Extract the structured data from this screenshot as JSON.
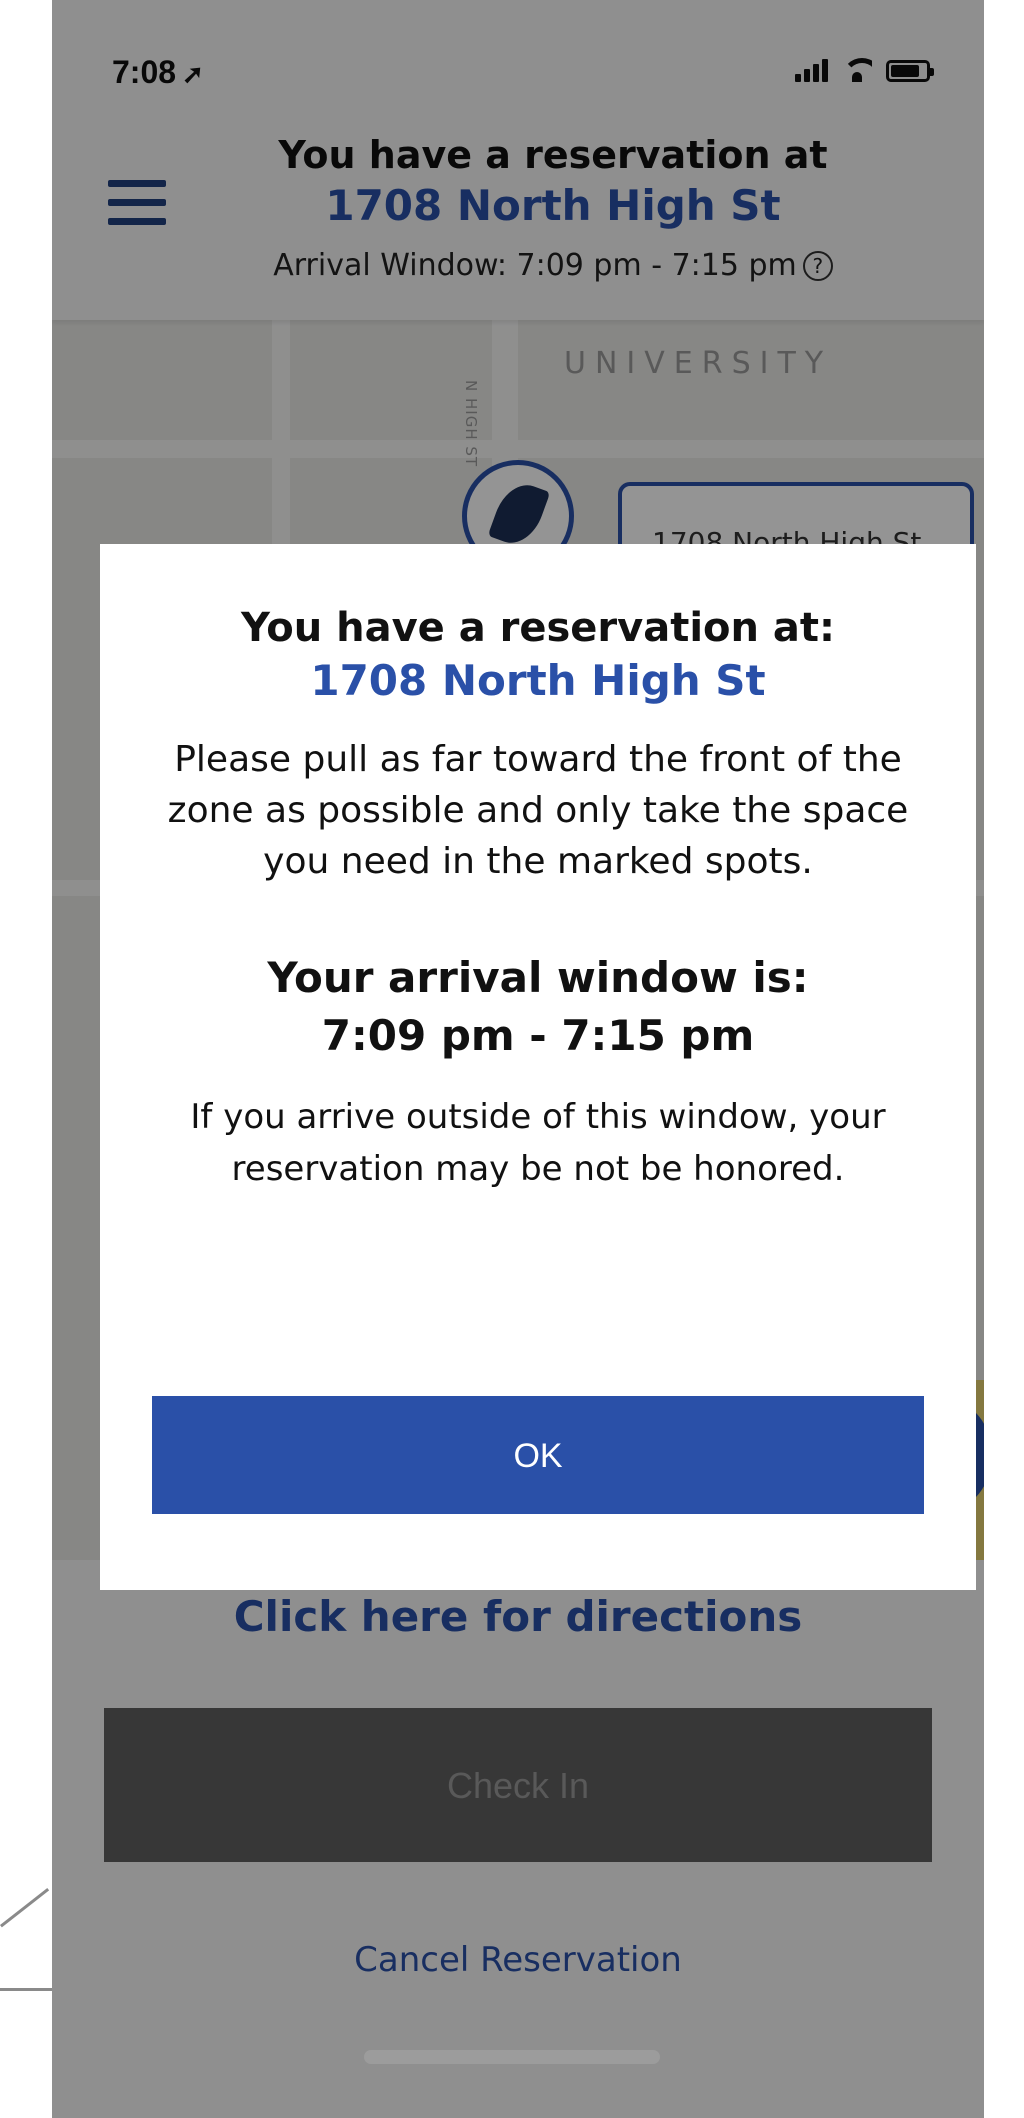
{
  "status_bar": {
    "time": "7:08",
    "location_icon": "location-arrow-icon",
    "signal_icon": "cellular-signal-icon",
    "wifi_icon": "wifi-icon",
    "battery_icon": "battery-icon"
  },
  "header": {
    "menu_icon": "hamburger-menu-icon",
    "title": "You have a reservation at",
    "address": "1708 North High St",
    "arrival_window": "Arrival Window: 7:09 pm - 7:15 pm",
    "help_icon": "question-circle-icon",
    "help_glyph": "?"
  },
  "map": {
    "area_label": "UNIVERSITY",
    "street_label": "N HIGH ST",
    "marker_icon": "location-marker-icon",
    "marker_callout": "1708 North High St"
  },
  "modal": {
    "title": "You have a reservation at:",
    "address": "1708 North High St",
    "instructions": "Please pull as far toward the front of the zone as possible and only take the space you need in the marked spots.",
    "window_label": "Your arrival window is:",
    "window_value": "7:09 pm - 7:15 pm",
    "warning": "If you arrive outside of this window, your reservation may be not be honored.",
    "ok_label": "OK"
  },
  "bottom": {
    "directions_label": "Click here for directions",
    "checkin_label": "Check In",
    "cancel_label": "Cancel Reservation"
  },
  "colors": {
    "brand_blue": "#2a50a8",
    "nav_blue": "#22407f",
    "disabled_gray": "#5f5f5f"
  }
}
